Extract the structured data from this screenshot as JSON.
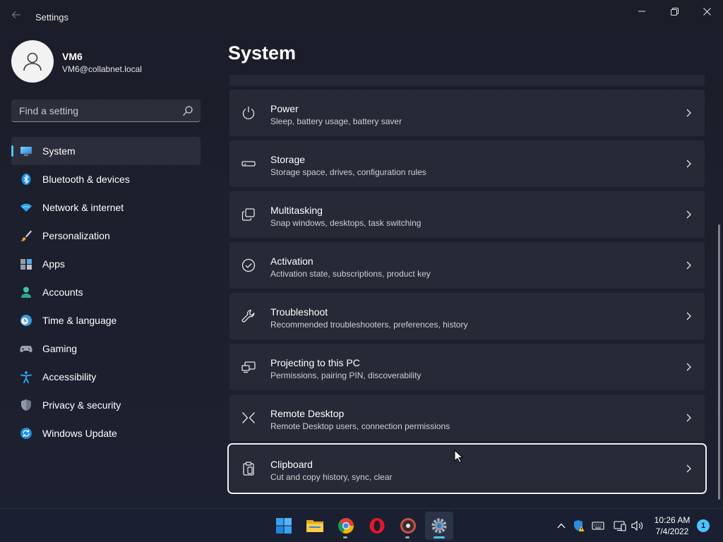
{
  "window": {
    "title": "Settings"
  },
  "profile": {
    "name": "VM6",
    "email": "VM6@collabnet.local"
  },
  "search": {
    "placeholder": "Find a setting"
  },
  "nav": {
    "items": [
      {
        "label": "System",
        "icon": "monitor-icon",
        "active": true
      },
      {
        "label": "Bluetooth & devices",
        "icon": "bluetooth-icon"
      },
      {
        "label": "Network & internet",
        "icon": "wifi-icon"
      },
      {
        "label": "Personalization",
        "icon": "brush-icon"
      },
      {
        "label": "Apps",
        "icon": "apps-icon"
      },
      {
        "label": "Accounts",
        "icon": "person-icon"
      },
      {
        "label": "Time & language",
        "icon": "clock-globe-icon"
      },
      {
        "label": "Gaming",
        "icon": "gamepad-icon"
      },
      {
        "label": "Accessibility",
        "icon": "accessibility-icon"
      },
      {
        "label": "Privacy & security",
        "icon": "shield-icon"
      },
      {
        "label": "Windows Update",
        "icon": "update-icon"
      }
    ]
  },
  "main": {
    "title": "System",
    "cards": [
      {
        "title": "Power",
        "subtitle": "Sleep, battery usage, battery saver",
        "icon": "power-icon"
      },
      {
        "title": "Storage",
        "subtitle": "Storage space, drives, configuration rules",
        "icon": "storage-icon"
      },
      {
        "title": "Multitasking",
        "subtitle": "Snap windows, desktops, task switching",
        "icon": "multitasking-icon"
      },
      {
        "title": "Activation",
        "subtitle": "Activation state, subscriptions, product key",
        "icon": "check-circle-icon"
      },
      {
        "title": "Troubleshoot",
        "subtitle": "Recommended troubleshooters, preferences, history",
        "icon": "wrench-icon"
      },
      {
        "title": "Projecting to this PC",
        "subtitle": "Permissions, pairing PIN, discoverability",
        "icon": "projecting-icon"
      },
      {
        "title": "Remote Desktop",
        "subtitle": "Remote Desktop users, connection permissions",
        "icon": "remote-desktop-icon"
      },
      {
        "title": "Clipboard",
        "subtitle": "Cut and copy history, sync, clear",
        "icon": "clipboard-icon",
        "focused": true
      }
    ]
  },
  "taskbar": {
    "apps": [
      "windows-start-icon",
      "file-explorer-icon",
      "chrome-icon",
      "opera-icon",
      "media-player-icon",
      "settings-gear-icon"
    ],
    "clock": {
      "time": "10:26 AM",
      "date": "7/4/2022"
    },
    "notification_count": "1"
  },
  "colors": {
    "accent": "#4cc2ff",
    "background": "#1c1f2b",
    "card": "#262a37"
  }
}
